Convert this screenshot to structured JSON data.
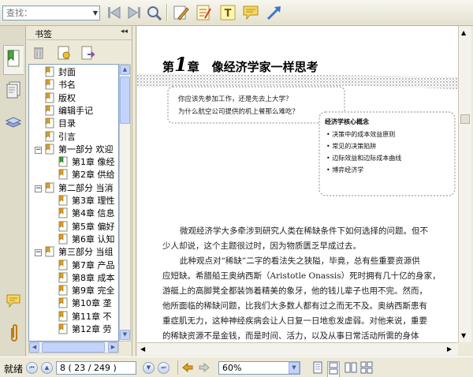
{
  "toolbar": {
    "search_placeholder": "查找：",
    "tools": [
      "back-icon",
      "forward-icon",
      "find-icon",
      "highlight-pen-icon",
      "note-pad-icon",
      "text-tool-icon",
      "comment-icon",
      "arrow-icon"
    ]
  },
  "bookmarks": {
    "title": "书签",
    "collapse": "◂◂",
    "items": [
      {
        "label": "封面",
        "level": 0
      },
      {
        "label": "书名",
        "level": 0
      },
      {
        "label": "版权",
        "level": 0
      },
      {
        "label": "编辑手记",
        "level": 0
      },
      {
        "label": "目录",
        "level": 0
      },
      {
        "label": "引言",
        "level": 0
      },
      {
        "label": "第一部分  欢迎",
        "level": 0,
        "toggle": "−"
      },
      {
        "label": "第1章  像经",
        "level": 1,
        "active": true
      },
      {
        "label": "第2章  供给",
        "level": 1
      },
      {
        "label": "第二部分  当消",
        "level": 0,
        "toggle": "−"
      },
      {
        "label": "第3章  理性",
        "level": 1
      },
      {
        "label": "第4章  信息",
        "level": 1
      },
      {
        "label": "第5章  偏好",
        "level": 1
      },
      {
        "label": "第6章  认知",
        "level": 1
      },
      {
        "label": "第三部分  当组",
        "level": 0,
        "toggle": "−"
      },
      {
        "label": "第7章  产品",
        "level": 1
      },
      {
        "label": "第8章  成本",
        "level": 1
      },
      {
        "label": "第9章  完全",
        "level": 1
      },
      {
        "label": "第10章  垄",
        "level": 1
      },
      {
        "label": "第11章  不",
        "level": 1
      },
      {
        "label": "第12章  劳",
        "level": 1
      }
    ]
  },
  "document": {
    "chapter_prefix": "第",
    "chapter_num": "1",
    "chapter_suffix": "章",
    "chapter_title": "像经济学家一样思考",
    "questions": [
      "你应该先参加工作，还是先去上大学？",
      "为什么航空公司提供的机上餐那么难吃？"
    ],
    "core_title": "经济学核心概念",
    "core_items": [
      "决策中的成本效益原则",
      "常见的决策陷阱",
      "边际效益和边际成本曲线",
      "博弈经济学"
    ],
    "paragraph1": [
      "微观经济学大多牵涉到研究人类在稀缺条件下如何选择的问题。但不",
      "少人却说，这个主题很过时，因为物质匮乏早成过去。"
    ],
    "paragraph2": [
      "此种观点对“稀缺”二字的看法失之狭隘，毕竟，总有些重要资源供",
      "应短缺。希腊船王奥纳西斯（Aristotle Onassis）死时拥有几十亿的身家，",
      "游艇上的高脚凳全都装饰着精美的象牙，他的钱儿辈子也用不完。然而，",
      "他所面临的稀缺问题，比我们大多数人都有过之而无不及。奥纳西斯患有",
      "重症肌无力，这种神经疾病会让人日复一日地愈发虚弱。对他来说，重要",
      "的稀缺资源不是金钱，而是时间、活力，以及从事日常活动所需的身体"
    ]
  },
  "status": {
    "ready": "就绪",
    "page_box": "8  ( 23 / 249 )",
    "zoom": "60%"
  }
}
